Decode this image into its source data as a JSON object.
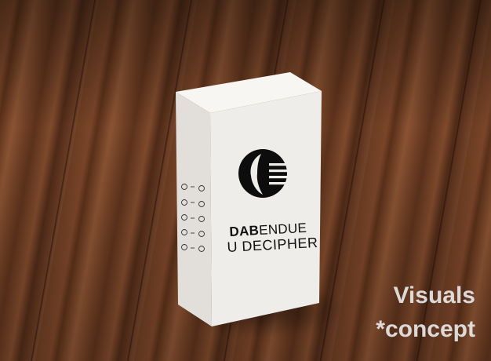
{
  "photo": {
    "subject": "product-box",
    "surface": "wood-floor"
  },
  "box": {
    "brand_bold": "DAB",
    "brand_rest": "ENDUE",
    "product_name": "U DECIPHER"
  },
  "watermark": {
    "line1": "Visuals",
    "line2": "*concept"
  },
  "colors": {
    "box_front": "#efedea",
    "box_side": "#e2dfdb",
    "box_top": "#f7f6f3",
    "logo": "#0d0d0d"
  }
}
